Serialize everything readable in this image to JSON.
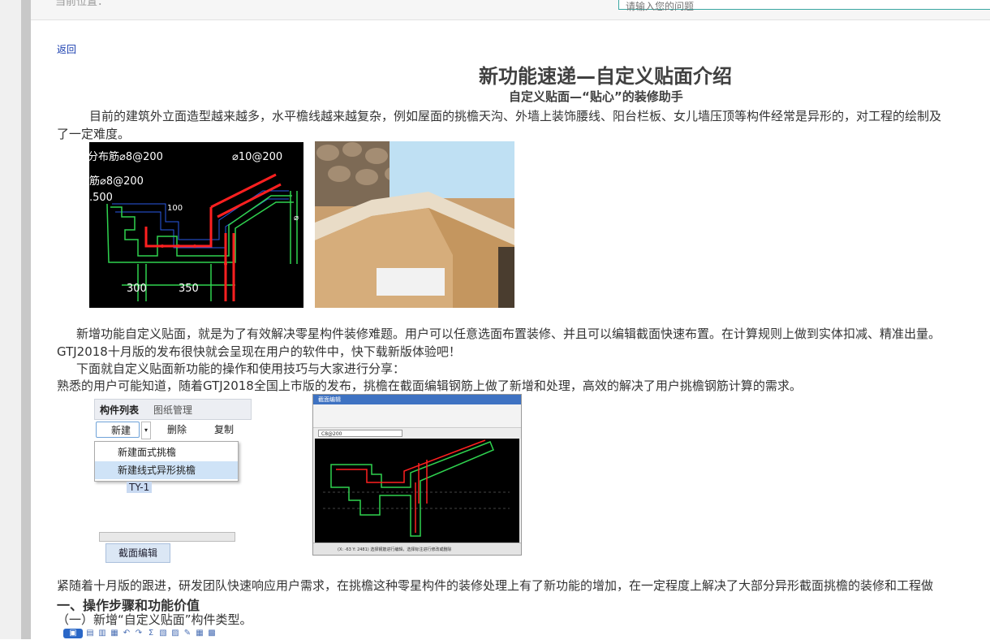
{
  "header": {
    "breadcrumb_label": "当前位置：",
    "search_placeholder": "请输入您的问题"
  },
  "article": {
    "back_link": "返回",
    "title": "新功能速递—自定义贴面介绍",
    "subtitle": "自定义贴面—“贴心”的装修助手",
    "intro_line1": "目前的建筑外立面造型越来越多，水平檐线越来越复杂，例如屋面的挑檐天沟、外墙上装饰腰线、阳台栏板、女儿墙压顶等构件经常是异形的，对工程的绘制及",
    "intro_line2": "了一定难度。",
    "para2_line1": "新增功能自定义贴面，就是为了有效解决零星构件装修难题。用户可以任意选面布置装修、并且可以编辑截面快速布置。在计算规则上做到实体扣减、精准出量。",
    "para2_line2": "GTJ2018十月版的发布很快就会呈现在用户的软件中，快下载新版体验吧！",
    "para3": "下面就自定义贴面新功能的操作和使用技巧与大家进行分享：",
    "para4": "熟悉的用户可能知道，随着GTJ2018全国上市版的发布，挑檐在截面编辑钢筋上做了新增和处理，高效的解决了用户挑檐钢筋计算的需求。",
    "para5": "紧随着十月版的跟进，研发团队快速响应用户需求，在挑檐这种零星构件的装修处理上有了新功能的增加，在一定程度上解决了大部分异形截面挑檐的装修和工程做",
    "section1_heading": "一、操作步骤和功能价值",
    "step1": "（一）新增“自定义贴面”构件类型。"
  },
  "figure1": {
    "labels": [
      "分布筋⌀8@200",
      "⌀10@200",
      "筋⌀8@200",
      ".500",
      "300",
      "350",
      "100",
      "⌀"
    ]
  },
  "figure3": {
    "tab_component_list": "构件列表",
    "tab_drawing_manage": "图纸管理",
    "btn_new": "新建",
    "btn_delete": "删除",
    "btn_copy": "复制",
    "menu_item_1": "新建面式挑檐",
    "menu_item_2": "新建线式异形挑檐",
    "item_name": "TY-1",
    "btn_section_edit": "截面编辑"
  },
  "figure4": {
    "window_title": "截面编辑",
    "select_value": "C8@200",
    "status_text": "(X: -63 Y: 2481)  选择钢筋进行编辑，选择标注进行修改或删除"
  },
  "colors": {
    "link": "#1a3fb0",
    "search_border": "#3aa7a2",
    "cad_green": "#2fd34f",
    "cad_red": "#ff2020",
    "cad_blue": "#2f64ff"
  },
  "icons": [
    "save-icon",
    "save-as-icon",
    "open-icon",
    "undo-icon",
    "redo-icon",
    "sum-icon",
    "report-icon",
    "preview-icon",
    "pen-icon",
    "table-icon",
    "print-icon"
  ]
}
